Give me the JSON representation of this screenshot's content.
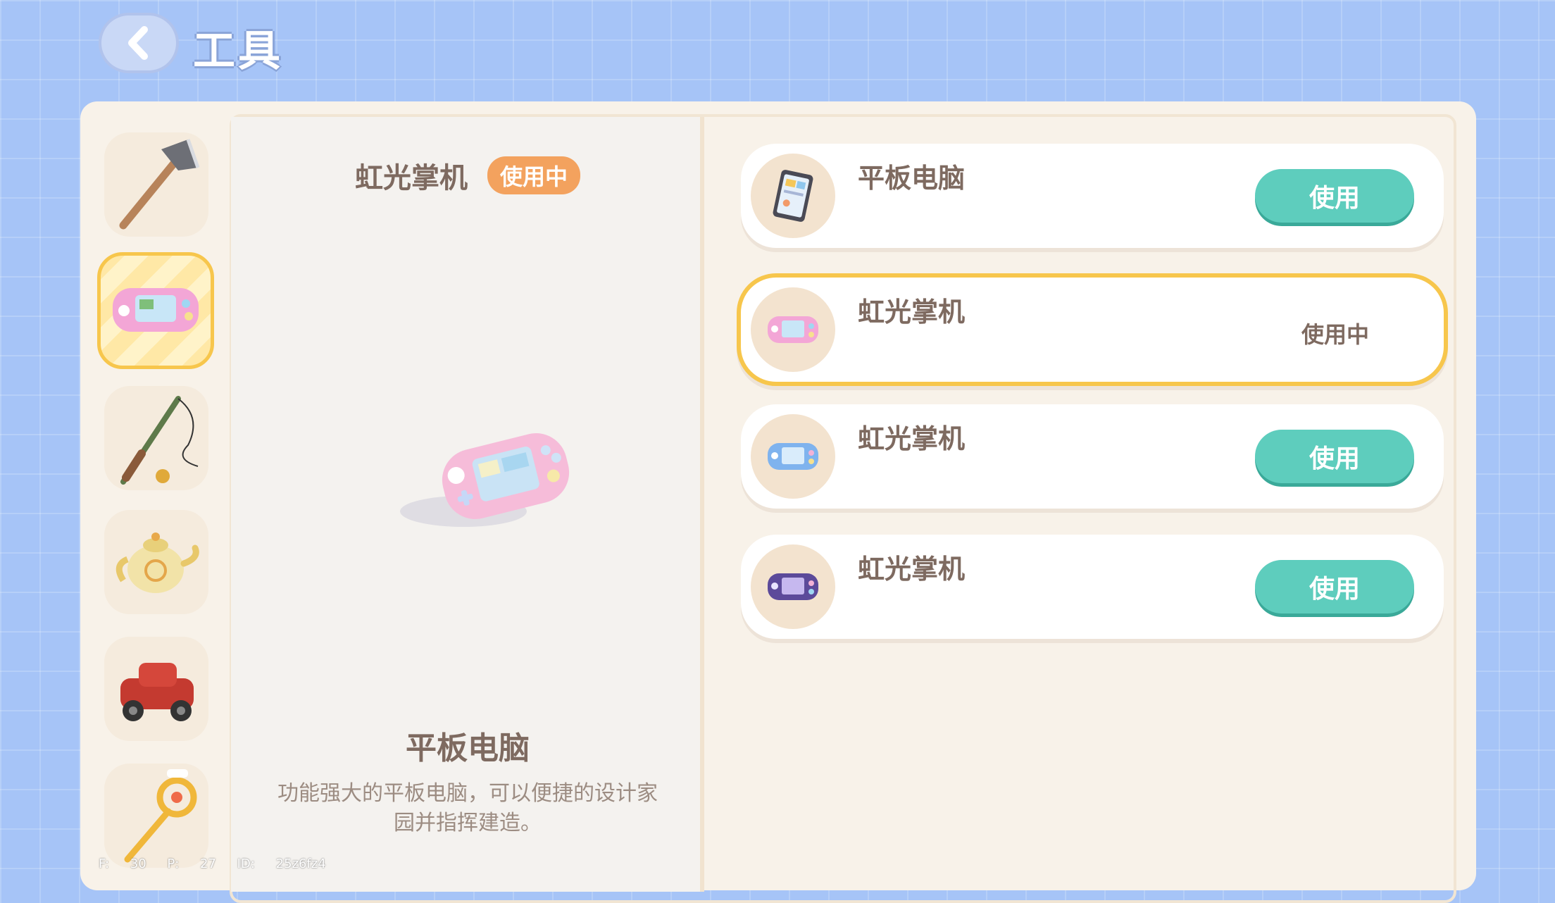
{
  "header": {
    "title": "工具",
    "back_icon": "chevron-left-icon"
  },
  "sidebar": {
    "items": [
      {
        "name": "axe",
        "icon": "axe-icon",
        "active": false
      },
      {
        "name": "handheld",
        "icon": "handheld-console-icon",
        "active": true
      },
      {
        "name": "fishing-rod",
        "icon": "fishing-rod-icon",
        "active": false
      },
      {
        "name": "teapot",
        "icon": "teapot-icon",
        "active": false
      },
      {
        "name": "toy-car",
        "icon": "toy-car-icon",
        "active": false
      },
      {
        "name": "wand",
        "icon": "magic-wand-icon",
        "active": false
      }
    ]
  },
  "preview": {
    "name": "虹光掌机",
    "badge": "使用中",
    "title": "平板电脑",
    "description": "功能强大的平板电脑，可以便捷的设计家园并指挥建造。"
  },
  "list": {
    "cards": [
      {
        "name": "平板电脑",
        "icon": "tablet-icon",
        "action": "使用",
        "selected": false
      },
      {
        "name": "虹光掌机",
        "icon": "pink-handheld-icon",
        "status": "使用中",
        "selected": true
      },
      {
        "name": "虹光掌机",
        "icon": "blue-handheld-icon",
        "action": "使用",
        "selected": false
      },
      {
        "name": "虹光掌机",
        "icon": "purple-handheld-icon",
        "action": "使用",
        "selected": false
      }
    ]
  },
  "debug": {
    "f": "F: 30",
    "p": "P: 27",
    "id": "ID: 25z6fz4"
  },
  "colors": {
    "accent": "#5ecdbd",
    "selected_border": "#f7c64c",
    "badge": "#f3a25e",
    "background": "#a6c4f7"
  }
}
